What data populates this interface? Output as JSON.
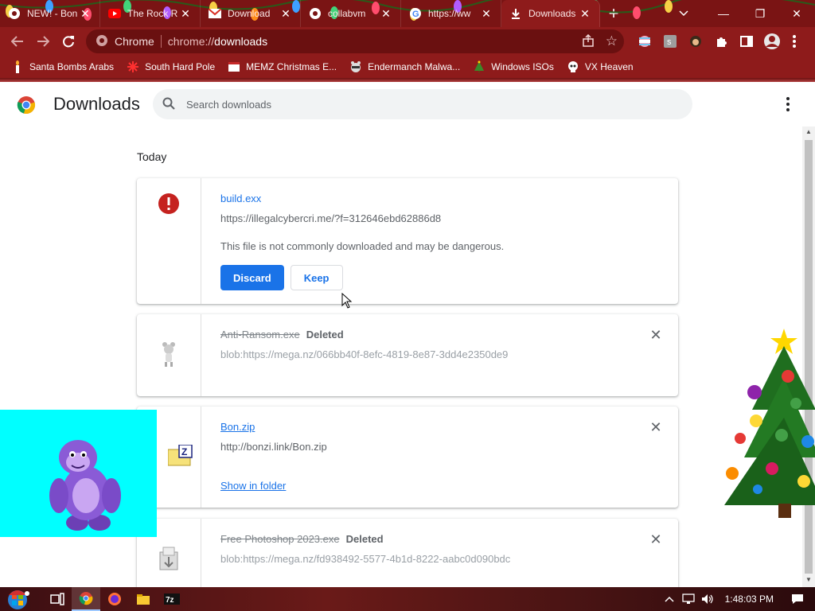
{
  "tabs": [
    {
      "title": "NEW! - Bon",
      "icon": "globe-icon",
      "active": false
    },
    {
      "title": "The Rock R",
      "icon": "youtube-icon",
      "active": false
    },
    {
      "title": "Download",
      "icon": "gmail-icon",
      "active": false
    },
    {
      "title": "collabvm",
      "icon": "globe-icon",
      "active": false
    },
    {
      "title": "https://ww",
      "icon": "google-icon",
      "active": false
    },
    {
      "title": "Downloads",
      "icon": "download-icon",
      "active": true
    }
  ],
  "window_controls": {
    "minimize": "—",
    "restore": "❐",
    "close": "✕"
  },
  "omnibox": {
    "site_label": "Chrome",
    "scheme": "chrome://",
    "host": "downloads"
  },
  "bookmarks": [
    {
      "label": "Santa Bombs Arabs",
      "icon": "candle-icon"
    },
    {
      "label": "South Hard Pole",
      "icon": "snowflake-icon"
    },
    {
      "label": "MEMZ Christmas E...",
      "icon": "window-icon"
    },
    {
      "label": "Endermanch Malwa...",
      "icon": "raccoon-icon"
    },
    {
      "label": "Windows ISOs",
      "icon": "tree-icon"
    },
    {
      "label": "VX Heaven",
      "icon": "skull-icon"
    }
  ],
  "header": {
    "title": "Downloads",
    "search_placeholder": "Search downloads"
  },
  "section_date": "Today",
  "downloads": [
    {
      "name": "build.exx",
      "url": "https://illegalcybercri.me/?f=312646ebd62886d8",
      "warning": "This file is not commonly downloaded and may be dangerous.",
      "discard_label": "Discard",
      "keep_label": "Keep",
      "icon": "danger-icon"
    },
    {
      "name": "Anti-Ransom.exe",
      "status": "Deleted",
      "url": "blob:https://mega.nz/066bb40f-8efc-4819-8e87-3dd4e2350de9",
      "icon": "mouse-figure-icon"
    },
    {
      "name": "Bon.zip",
      "url": "http://bonzi.link/Bon.zip",
      "show_in_folder": "Show in folder",
      "icon": "zip-folder-icon"
    },
    {
      "name": "Free Photoshop 2023.exe",
      "status": "Deleted",
      "url": "blob:https://mega.nz/fd938492-5577-4b1d-8222-aabc0d090bdc",
      "icon": "installer-icon"
    }
  ],
  "taskbar": {
    "items": [
      "start-orb-icon",
      "task-view-icon",
      "chrome-icon",
      "firefox-icon",
      "file-explorer-icon",
      "7zip-icon"
    ],
    "clock": "1:48:03 PM"
  },
  "colors": {
    "tabstrip": "#7a1414",
    "toolbar": "#8e1b1b",
    "accent": "#1a73e8",
    "danger": "#c5221f",
    "overlay_cyan": "#00ffff"
  }
}
